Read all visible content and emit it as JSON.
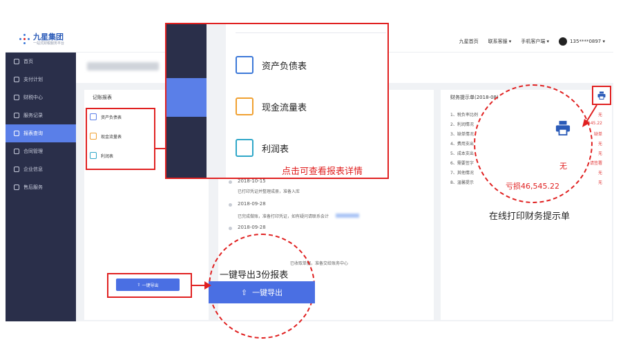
{
  "header": {
    "brand": "九星集团",
    "brand_sub": "一站式财税服务平台",
    "nav": [
      "九星首页",
      "联系客服 ▾",
      "手机客户端 ▾"
    ],
    "user": "135****0897 ▾"
  },
  "sidebar": {
    "items": [
      {
        "label": "首页",
        "icon": "home-icon"
      },
      {
        "label": "支付计划",
        "icon": "wallet-icon"
      },
      {
        "label": "财税中心",
        "icon": "shield-icon"
      },
      {
        "label": "服务记录",
        "icon": "record-icon"
      },
      {
        "label": "报表查询",
        "icon": "report-icon",
        "active": true
      },
      {
        "label": "合同管理",
        "icon": "contract-icon"
      },
      {
        "label": "企业信息",
        "icon": "building-icon"
      },
      {
        "label": "售后服务",
        "icon": "bell-icon"
      }
    ]
  },
  "left_panel": {
    "title": "记账报表",
    "reports": [
      "资产负债表",
      "现金流量表",
      "利润表"
    ],
    "export_label": "一键导出"
  },
  "timeline": [
    {
      "date": "2018-10-15",
      "text": "已打印凭证并整理成册，准备入库"
    },
    {
      "date": "2018-09-28",
      "text": "已完成做账，准备打印凭证，如有疑问请联系会计"
    },
    {
      "date": "2018-09-28",
      "text": "已收取单据，准备交给账务中心"
    }
  ],
  "right_panel": {
    "title": "财务提示单(2018-08)",
    "rows": [
      "1、税负率比例",
      "2、利润情况",
      "3、缺单情况",
      "4、费用支出",
      "5、成本支出",
      "6、需要签字",
      "7、其他情况",
      "8、温馨提示"
    ],
    "values": [
      "无",
      "545.22",
      "缺单",
      "无",
      "无",
      "请签署",
      "无",
      "无"
    ]
  },
  "popup": {
    "items": [
      "资产负债表",
      "现金流量表",
      "利润表"
    ],
    "caption": "点击可查看报表详情"
  },
  "callouts": {
    "export_caption": "一键导出3份报表",
    "export_button": "一键导出",
    "print_caption": "在线打印财务提示单",
    "circle_none": "无",
    "circle_loss": "亏损46,545.22"
  },
  "colors": {
    "sidebar_bg": "#2a2f4a",
    "active": "#5a7fe8",
    "primary_button": "#4a6fe3",
    "annotation_red": "#e02020"
  }
}
